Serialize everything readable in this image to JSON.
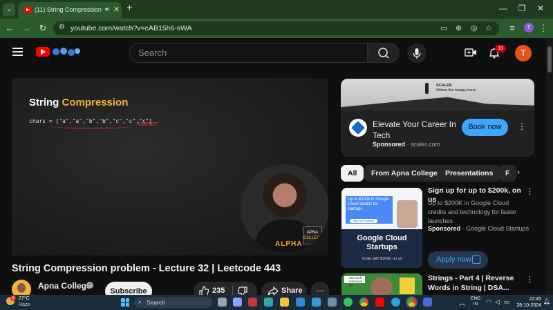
{
  "browser": {
    "tab_title": "(11) String Compression pr",
    "url_site_icon": "tune-icon",
    "url": "youtube.com/watch?v=cAB15h6-sWA",
    "profile_initial": "T",
    "window_controls": [
      "—",
      "❐",
      "✕"
    ]
  },
  "youtube": {
    "search_placeholder": "Search",
    "notifications_count": "10",
    "account_initial": "T"
  },
  "video": {
    "board_title_plain": "String ",
    "board_title_highlight": "Compression",
    "board_code": "chars = [\"a\",\"a\",\"b\",\"b\",\"c\",\"c\",\"c\"]",
    "board_scribble": "vector",
    "presenter_shirt_text": "ALPHA",
    "presenter_badge_line1": "APNA",
    "presenter_badge_line2": "COLLEGE",
    "title": "String Compression problem - Lecture 32 | Leetcode 443",
    "channel_name": "Apna College",
    "subscribe_label": "Subscribe",
    "like_count": "235",
    "share_label": "Share"
  },
  "ad": {
    "banner_brand": "SCALER",
    "banner_tagline": "Where the hungry learn",
    "title": "Elevate Your Career In Tech",
    "sponsored_label": "Sponsored",
    "advertiser": "scaler.com",
    "cta": "Book now"
  },
  "chips": [
    "All",
    "From Apna College",
    "Presentations",
    "F"
  ],
  "sponsored_card": {
    "thumb_blue_text": "Up to $200k in Google Cloud credits for startups",
    "thumb_pill": "Sign up for startups",
    "thumb_title": "Google Cloud Startups",
    "thumb_subtitle": "Scale with $200k, on us",
    "title": "Sign up for up to $200k, on us",
    "description": "Up to $200K in Google Cloud credits and technology for faster launches",
    "sponsored_label": "Sponsored",
    "advertiser": "Google Cloud Startups",
    "cta": "Apply now"
  },
  "recommendation": {
    "thumb_badge": "Microsoft Interview Qs",
    "title": "Strings - Part 4 | Reverse Words in String | DSA..."
  },
  "taskbar": {
    "weather_alert": "1",
    "temperature": "27°C",
    "condition": "Haze",
    "search_label": "Search",
    "lang_line1": "ENG",
    "lang_line2": "IN",
    "time": "22:45",
    "date": "28-10-2024"
  }
}
